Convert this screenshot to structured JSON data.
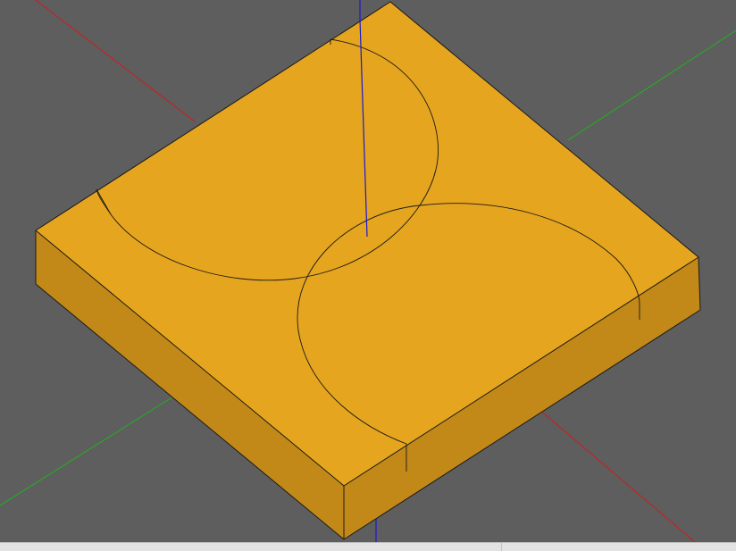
{
  "viewport": {
    "background": "#5e5e5e",
    "model": {
      "top_face_color": "#e6a51f",
      "left_face_color": "#c28918",
      "right_face_color": "#c28918",
      "edge_color": "#1a1a1a"
    },
    "axes": [
      {
        "name": "x-axis",
        "color": "#d21a1a"
      },
      {
        "name": "y-axis",
        "color": "#1eb41e"
      },
      {
        "name": "z-axis",
        "color": "#1a1acd"
      }
    ]
  },
  "statusbar": {
    "left_text": "",
    "right_text": ""
  }
}
